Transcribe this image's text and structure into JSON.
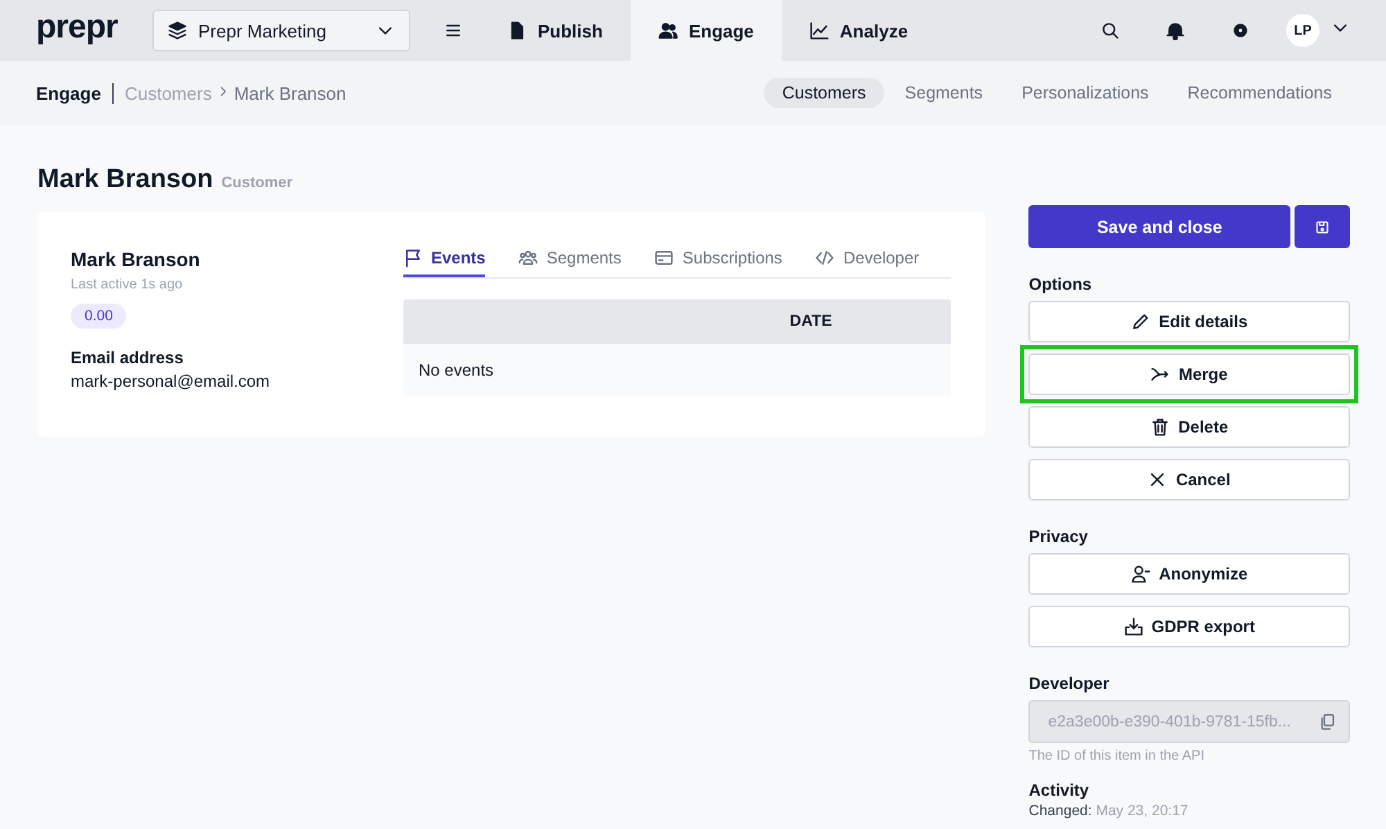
{
  "logo": "prepr",
  "workspace": {
    "label": "Prepr Marketing"
  },
  "nav": [
    {
      "label": "Publish",
      "kind": "publish",
      "selected": false
    },
    {
      "label": "Engage",
      "kind": "engage",
      "selected": true
    },
    {
      "label": "Analyze",
      "kind": "analyze",
      "selected": false
    }
  ],
  "user": {
    "initials": "LP"
  },
  "breadcrumb": {
    "section": "Engage",
    "parent": "Customers",
    "current": "Mark Branson"
  },
  "subnav": [
    {
      "label": "Customers",
      "selected": true
    },
    {
      "label": "Segments",
      "selected": false
    },
    {
      "label": "Personalizations",
      "selected": false
    },
    {
      "label": "Recommendations",
      "selected": false
    }
  ],
  "page": {
    "title": "Mark Branson",
    "subtitle": "Customer"
  },
  "profile": {
    "name": "Mark Branson",
    "last_active": "Last active 1s ago",
    "score": "0.00",
    "email_label": "Email address",
    "email": "mark-personal@email.com"
  },
  "tabs": [
    {
      "label": "Events",
      "kind": "flag",
      "selected": true
    },
    {
      "label": "Segments",
      "kind": "users",
      "selected": false
    },
    {
      "label": "Subscriptions",
      "kind": "card",
      "selected": false
    },
    {
      "label": "Developer",
      "kind": "code",
      "selected": false
    }
  ],
  "table": {
    "columns": [
      "DATE"
    ],
    "empty": "No events"
  },
  "save_button": "Save and close",
  "options": {
    "title": "Options",
    "buttons": [
      {
        "label": "Edit details",
        "kind": "edit",
        "highlighted": false
      },
      {
        "label": "Merge",
        "kind": "merge",
        "highlighted": true
      },
      {
        "label": "Delete",
        "kind": "delete",
        "highlighted": false
      },
      {
        "label": "Cancel",
        "kind": "cancel",
        "highlighted": false
      }
    ]
  },
  "privacy": {
    "title": "Privacy",
    "buttons": [
      {
        "label": "Anonymize",
        "kind": "anonymize",
        "highlighted": false
      },
      {
        "label": "GDPR export",
        "kind": "export",
        "highlighted": false
      }
    ]
  },
  "developer": {
    "title": "Developer",
    "value": "e2a3e00b-e390-401b-9781-15fb...",
    "help": "The ID of this item in the API"
  },
  "activity": {
    "title": "Activity",
    "label": "Changed:",
    "value": "May 23, 20:17"
  }
}
